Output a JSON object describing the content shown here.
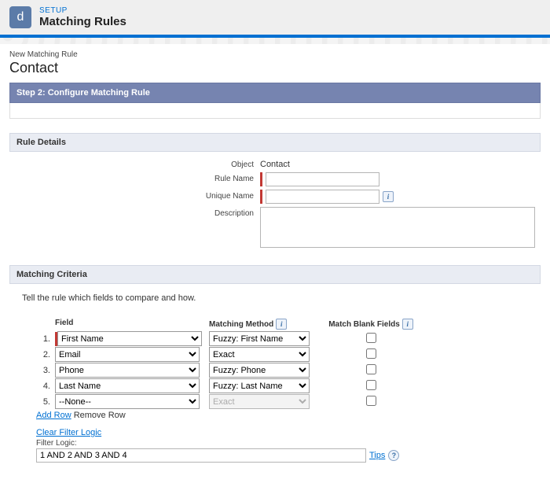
{
  "header": {
    "setup_label": "SETUP",
    "title": "Matching Rules",
    "app_icon_letter": "d"
  },
  "page": {
    "breadcrumb": "New Matching Rule",
    "heading": "Contact",
    "step_bar": "Step 2: Configure Matching Rule"
  },
  "rule_details": {
    "section_title": "Rule Details",
    "object_label": "Object",
    "object_value": "Contact",
    "rule_name_label": "Rule Name",
    "rule_name_value": "",
    "unique_name_label": "Unique Name",
    "unique_name_value": "",
    "description_label": "Description",
    "description_value": ""
  },
  "matching_criteria": {
    "section_title": "Matching Criteria",
    "instructions": "Tell the rule which fields to compare and how.",
    "columns": {
      "field": "Field",
      "method": "Matching Method",
      "blank": "Match Blank Fields"
    },
    "rows": [
      {
        "num": "1.",
        "field": "First Name",
        "method": "Fuzzy: First Name",
        "blank": false,
        "required": true,
        "method_disabled": false
      },
      {
        "num": "2.",
        "field": "Email",
        "method": "Exact",
        "blank": false,
        "required": false,
        "method_disabled": false
      },
      {
        "num": "3.",
        "field": "Phone",
        "method": "Fuzzy: Phone",
        "blank": false,
        "required": false,
        "method_disabled": false
      },
      {
        "num": "4.",
        "field": "Last Name",
        "method": "Fuzzy: Last Name",
        "blank": false,
        "required": false,
        "method_disabled": false
      },
      {
        "num": "5.",
        "field": "--None--",
        "method": "Exact",
        "blank": false,
        "required": false,
        "method_disabled": true
      }
    ],
    "add_row": "Add Row",
    "remove_row": "Remove Row",
    "clear_filter": "Clear Filter Logic",
    "filter_label": "Filter Logic:",
    "filter_value": "1 AND 2 AND 3 AND 4",
    "tips": "Tips"
  }
}
